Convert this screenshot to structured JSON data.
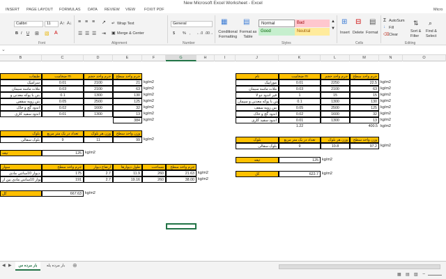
{
  "app": {
    "title": "New Microsoft Excel Worksheet - Excel",
    "menu": [
      "INSERT",
      "PAGE LAYOUT",
      "FORMULAS",
      "DATA",
      "REVIEW",
      "VIEW",
      "FOXIT PDF"
    ],
    "ribbon_right_label": "Micro"
  },
  "ribbon": {
    "font_name": "Calibri",
    "font_size": "11",
    "bold": "B",
    "italic": "I",
    "underline": "U",
    "wrap_text": "Wrap Text",
    "merge_center": "Merge & Center",
    "number_format": "General",
    "currency": "$",
    "percent": "%",
    "comma": ",",
    "conditional_formatting": "Conditional Formatting",
    "format_as_table": "Format as Table",
    "styles": {
      "normal": "Normal",
      "bad": "Bad",
      "good": "Good",
      "neutral": "Neutral"
    },
    "insert": "Insert",
    "delete": "Delete",
    "format": "Format",
    "autosum": "AutoSum",
    "fill": "Fill",
    "clear": "Clear",
    "sort_filter": "Sort & Filter",
    "find_select": "Find & Select",
    "groups": {
      "font": "Font",
      "alignment": "Alignment",
      "number": "Number",
      "styles": "Styles",
      "cells": "Cells",
      "editing": "Editing"
    }
  },
  "columns": [
    "B",
    "C",
    "D",
    "E",
    "F",
    "G",
    "H",
    "I",
    "J",
    "K",
    "L",
    "M",
    "N",
    "O"
  ],
  "left_tables": {
    "header": {
      "c1": "جرم واحد سطح",
      "c2": "جرم واحد حجم",
      "c3": "ضخامت m",
      "c4": "طبقات"
    },
    "rows": [
      {
        "e": "21",
        "d": "2100",
        "c": "0.01",
        "b": "سرامیک"
      },
      {
        "e": "63",
        "d": "2100",
        "c": "0.03",
        "b": "ملات ماسه سیمان"
      },
      {
        "e": "130",
        "d": "1300",
        "c": "0.1",
        "b": "بتن با پوکه معدنی و"
      },
      {
        "e": "125",
        "d": "2500",
        "c": "0.05",
        "b": "بتن زوبه سقفی"
      },
      {
        "e": "32",
        "d": "1600",
        "c": "0.02",
        "b": "اندود گچ و خاک"
      },
      {
        "e": "13",
        "d": "1300",
        "c": "0.01",
        "b": "اندود سفید کاری"
      }
    ],
    "total": "384",
    "unit": "kg/m2",
    "block_header": {
      "e": "وزن هر بلوک",
      "d": "وزن هر بلوک",
      "c": "تعداد در یک متر مربع",
      "b": "بلوک"
    },
    "block_header_e": "وزن واحد سطح",
    "block_row": {
      "e": "99",
      "d": "11",
      "c": "9",
      "b": "بلوک سفالی"
    },
    "partition_label": "تیغه",
    "partition_value": "125",
    "wall_header": {
      "f": "جرم واحد سطح",
      "e": "مساحت",
      "d": "طول دیوارها",
      "c": "ارتفاع دیوار",
      "c2": "جرم واحد سطح",
      "b": "سوار"
    },
    "wall_rows": [
      {
        "g": "21.63",
        "f": "260",
        "e": "11.9",
        "d": "2.7",
        "c": "175",
        "b": "دیوار 10سانتی مادی"
      },
      {
        "g": "38.00",
        "f": "260",
        "e": "19.16",
        "d": "2.7",
        "c": "191",
        "b": "دیوار 10سانتی مادی بین ار"
      }
    ],
    "wall_total_label": "کل",
    "wall_total": "667.63"
  },
  "right_tables": {
    "header": {
      "m": "جرم واحد سطح",
      "l": "جرم واحد حجم",
      "k": "ضخامت m",
      "j": "نام"
    },
    "rows": [
      {
        "m": "22.5",
        "l": "2250",
        "k": "0.01",
        "j": "موزاییک"
      },
      {
        "m": "63",
        "l": "2100",
        "k": "0.03",
        "j": "ملات ماسه سیمان"
      },
      {
        "m": "15",
        "l": "15",
        "k": "1",
        "j": "قیر اندود دو لا"
      },
      {
        "m": "130",
        "l": "1300",
        "k": "0.1",
        "j": "بتن با پوکه معدنی و سیمان"
      },
      {
        "m": "125",
        "l": "2500",
        "k": "0.05",
        "j": "بتن زوبه سقف"
      },
      {
        "m": "32",
        "l": "1600",
        "k": "0.02",
        "j": "اندود گچ و خاک"
      },
      {
        "m": "13",
        "l": "1300",
        "k": "0.01",
        "j": "اندود سفید کاری"
      }
    ],
    "k_total": "1.22",
    "m_total": "400.5",
    "unit": "kg/m2",
    "block_header": {
      "m": "وزن واحد سطح",
      "l": "وزن هر بلوک",
      "k": "تعداد در یک متر مربع",
      "j": "بلوک"
    },
    "block_row": {
      "m": "97.2",
      "l": "10.8",
      "k": "9",
      "j": "بلوک سفالی"
    },
    "partition_label": "تیغه",
    "partition_value": "125",
    "total_label": "کل",
    "total_value": "622.7"
  },
  "sheet_tabs": [
    "بار مرده س",
    "بار مرده پله"
  ],
  "colors": {
    "yellow": "#ffc000",
    "accent": "#217346"
  }
}
